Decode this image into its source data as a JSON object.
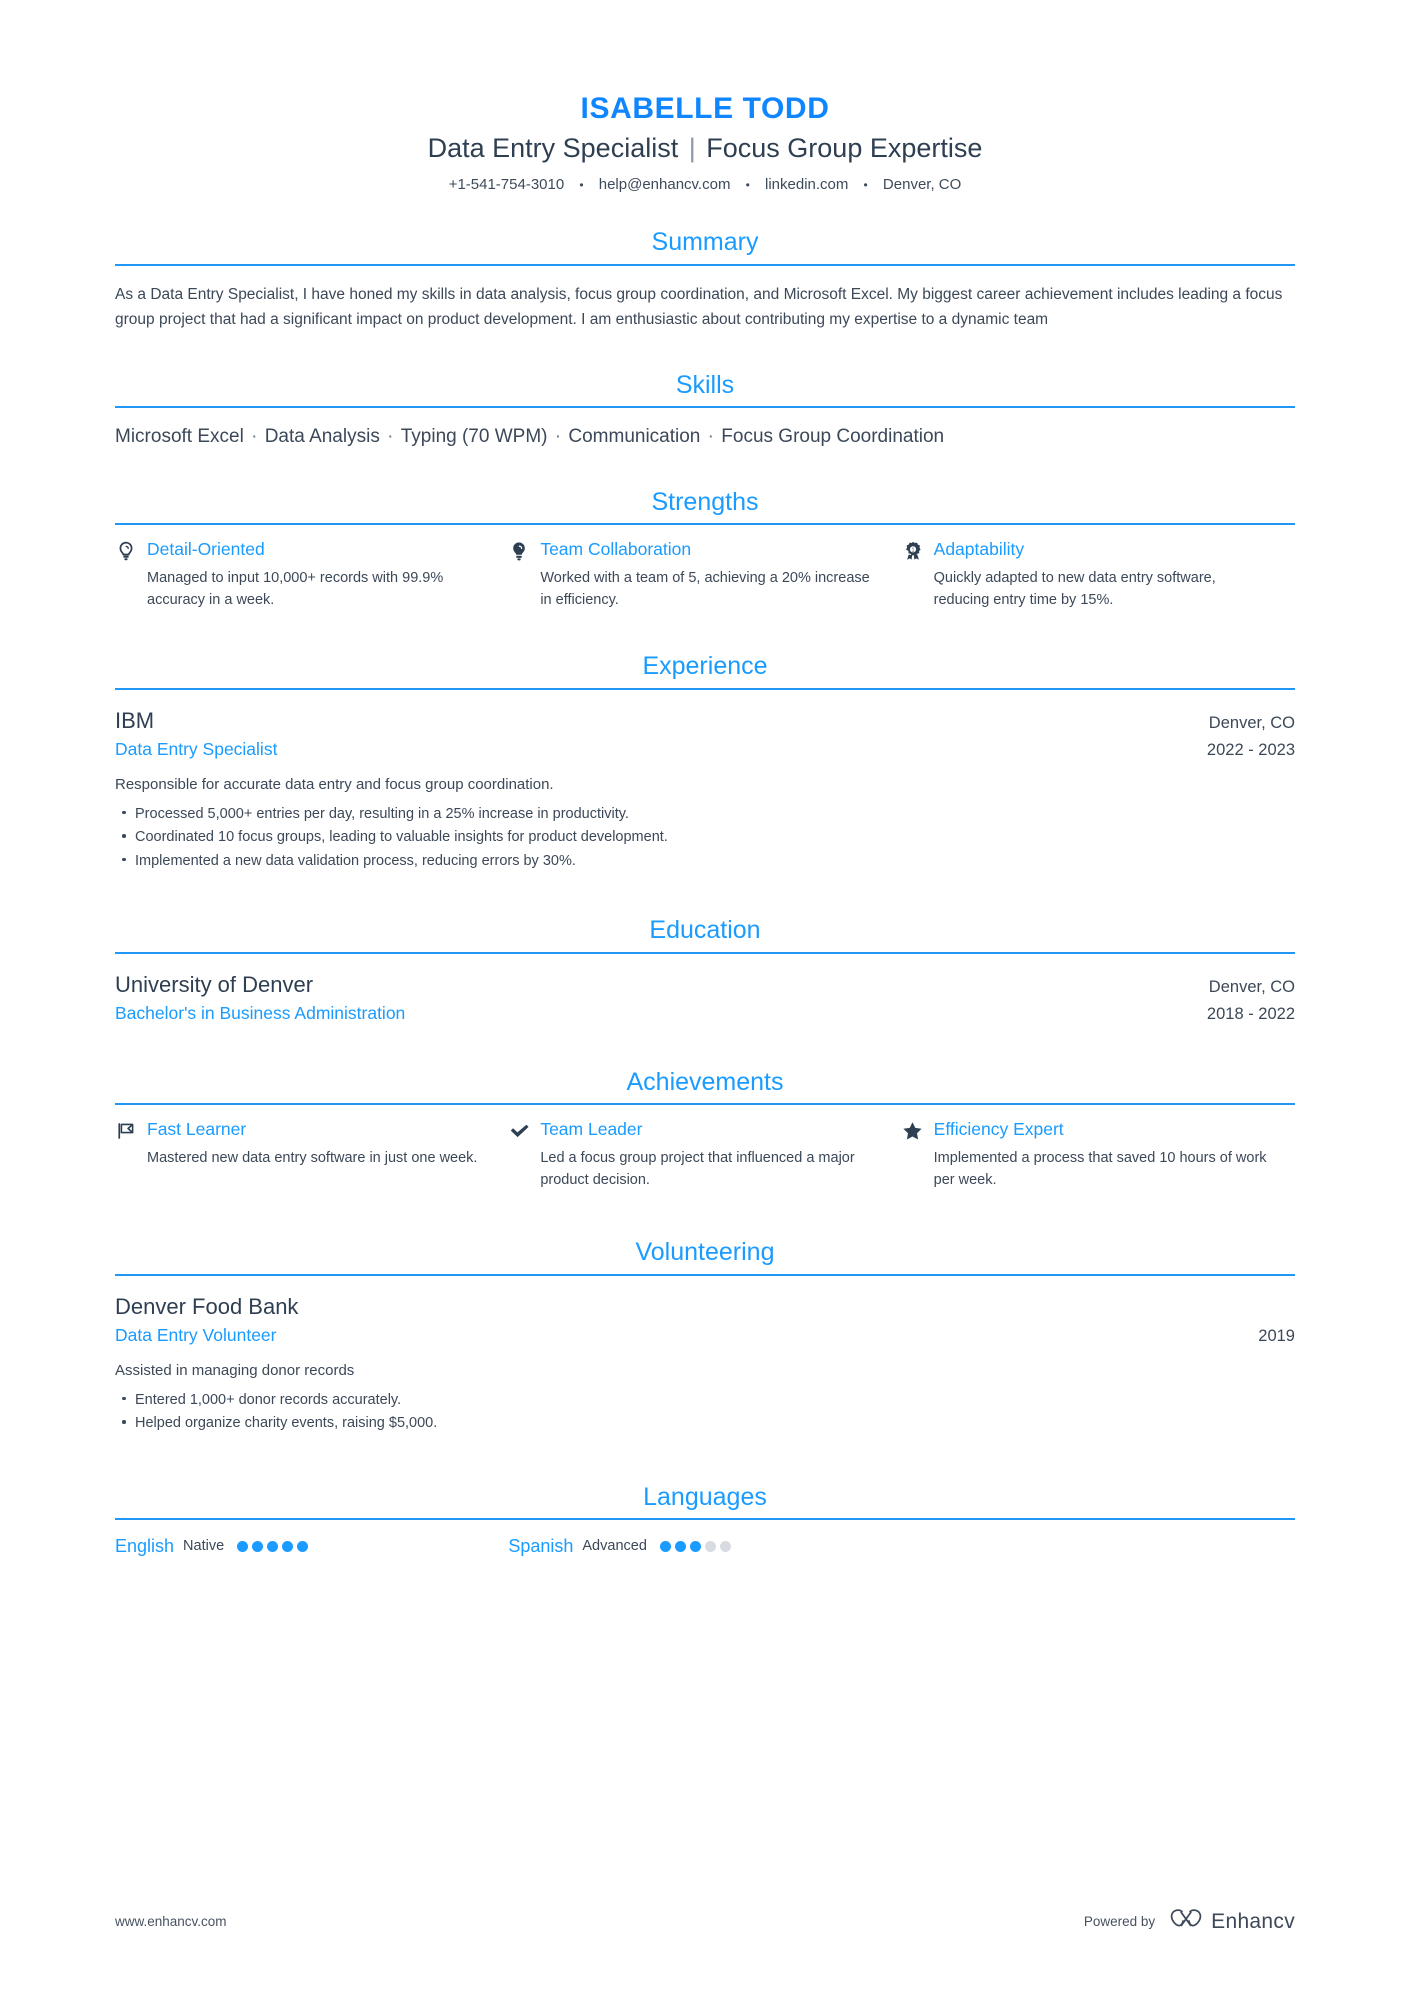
{
  "accent": {
    "blue": "#1a9bff",
    "name_blue": "#0f86ff",
    "rule": "#2196f3",
    "dark": "#2f3f52",
    "body": "#3c4858",
    "dot_off": "#d8dce0"
  },
  "header": {
    "name": "ISABELLE TODD",
    "title_left": "Data Entry Specialist",
    "title_divider": "|",
    "title_right": "Focus Group Expertise",
    "contact": {
      "phone": "+1-541-754-3010",
      "email": "help@enhancv.com",
      "linkedin": "linkedin.com",
      "location": "Denver, CO",
      "separator": "•"
    }
  },
  "sections": {
    "summary": {
      "heading": "Summary",
      "text": "As a Data Entry Specialist, I have honed my skills in data analysis, focus group coordination, and Microsoft Excel. My biggest career achievement includes leading a focus group project that had a significant impact on product development. I am enthusiastic about contributing my expertise to a dynamic team"
    },
    "skills": {
      "heading": "Skills",
      "separator": "·",
      "items": [
        "Microsoft Excel",
        "Data Analysis",
        "Typing (70 WPM)",
        "Communication",
        "Focus Group Coordination"
      ]
    },
    "strengths": {
      "heading": "Strengths",
      "items": [
        {
          "icon": "lightbulb-icon",
          "title": "Detail-Oriented",
          "desc": "Managed to input 10,000+ records with 99.9% accuracy in a week."
        },
        {
          "icon": "brainstorm-icon",
          "title": "Team Collaboration",
          "desc": "Worked with a team of 5, achieving a 20% increase in efficiency."
        },
        {
          "icon": "award-medal-icon",
          "title": "Adaptability",
          "desc": "Quickly adapted to new data entry software, reducing entry time by 15%."
        }
      ]
    },
    "experience": {
      "heading": "Experience",
      "items": [
        {
          "org": "IBM",
          "location": "Denver, CO",
          "role": "Data Entry Specialist",
          "date": "2022 - 2023",
          "summary": "Responsible for accurate data entry and focus group coordination.",
          "bullets": [
            "Processed 5,000+ entries per day, resulting in a 25% increase in productivity.",
            "Coordinated 10 focus groups, leading to valuable insights for product development.",
            "Implemented a new data validation process, reducing errors by 30%."
          ]
        }
      ]
    },
    "education": {
      "heading": "Education",
      "items": [
        {
          "org": "University of Denver",
          "location": "Denver, CO",
          "role": "Bachelor's in Business Administration",
          "date": "2018 - 2022"
        }
      ]
    },
    "achievements": {
      "heading": "Achievements",
      "items": [
        {
          "icon": "flag-icon",
          "title": "Fast Learner",
          "desc": "Mastered new data entry software in just one week."
        },
        {
          "icon": "check-icon",
          "title": "Team Leader",
          "desc": "Led a focus group project that influenced a major product decision."
        },
        {
          "icon": "star-icon",
          "title": "Efficiency Expert",
          "desc": "Implemented a process that saved 10 hours of work per week."
        }
      ]
    },
    "volunteering": {
      "heading": "Volunteering",
      "items": [
        {
          "org": "Denver Food Bank",
          "location": "",
          "role": "Data Entry Volunteer",
          "date": "2019",
          "summary": "Assisted in managing donor records",
          "bullets": [
            "Entered 1,000+ donor records accurately.",
            "Helped organize charity events, raising $5,000."
          ]
        }
      ]
    },
    "languages": {
      "heading": "Languages",
      "items": [
        {
          "name": "English",
          "level": "Native",
          "filled": 5,
          "total": 5
        },
        {
          "name": "Spanish",
          "level": "Advanced",
          "filled": 3,
          "total": 5
        }
      ]
    }
  },
  "footer": {
    "url": "www.enhancv.com",
    "powered_by": "Powered by",
    "brand": "Enhancv"
  }
}
